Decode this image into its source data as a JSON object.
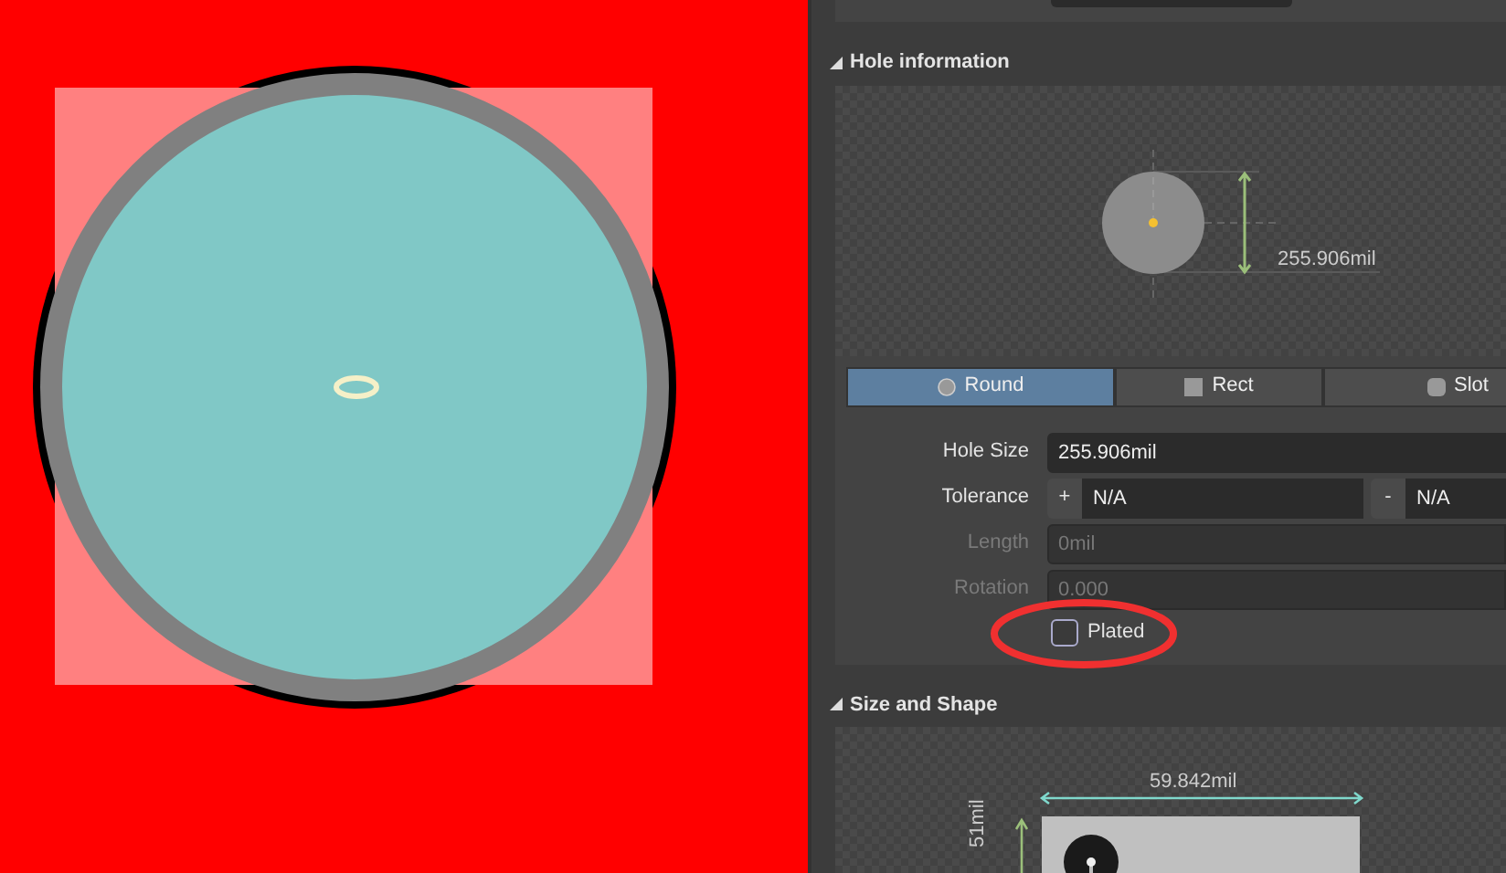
{
  "hole_information": {
    "title": "Hole information",
    "expanded": true,
    "preview_dimension": "255.906mil",
    "shape_tabs": [
      {
        "label": "Round",
        "kind": "circle",
        "selected": true
      },
      {
        "label": "Rect",
        "kind": "square",
        "selected": false
      },
      {
        "label": "Slot",
        "kind": "rounded",
        "selected": false
      }
    ],
    "fields": [
      {
        "kind": "text",
        "label": "Hole Size",
        "value": "255.906mil",
        "disabled": false
      },
      {
        "kind": "tolerance",
        "label": "Tolerance",
        "plus_sign": "+",
        "plus_value": "N/A",
        "minus_sign": "-",
        "minus_value": "N/A",
        "disabled": false
      },
      {
        "kind": "text",
        "label": "Length",
        "value": "0mil",
        "disabled": true
      },
      {
        "kind": "text",
        "label": "Rotation",
        "value": "0.000",
        "disabled": true
      }
    ],
    "plated": {
      "label": "Plated",
      "checked": false
    }
  },
  "size_and_shape": {
    "title": "Size and Shape",
    "expanded": true,
    "width_dimension": "59.842mil",
    "height_dimension": "51mil"
  }
}
